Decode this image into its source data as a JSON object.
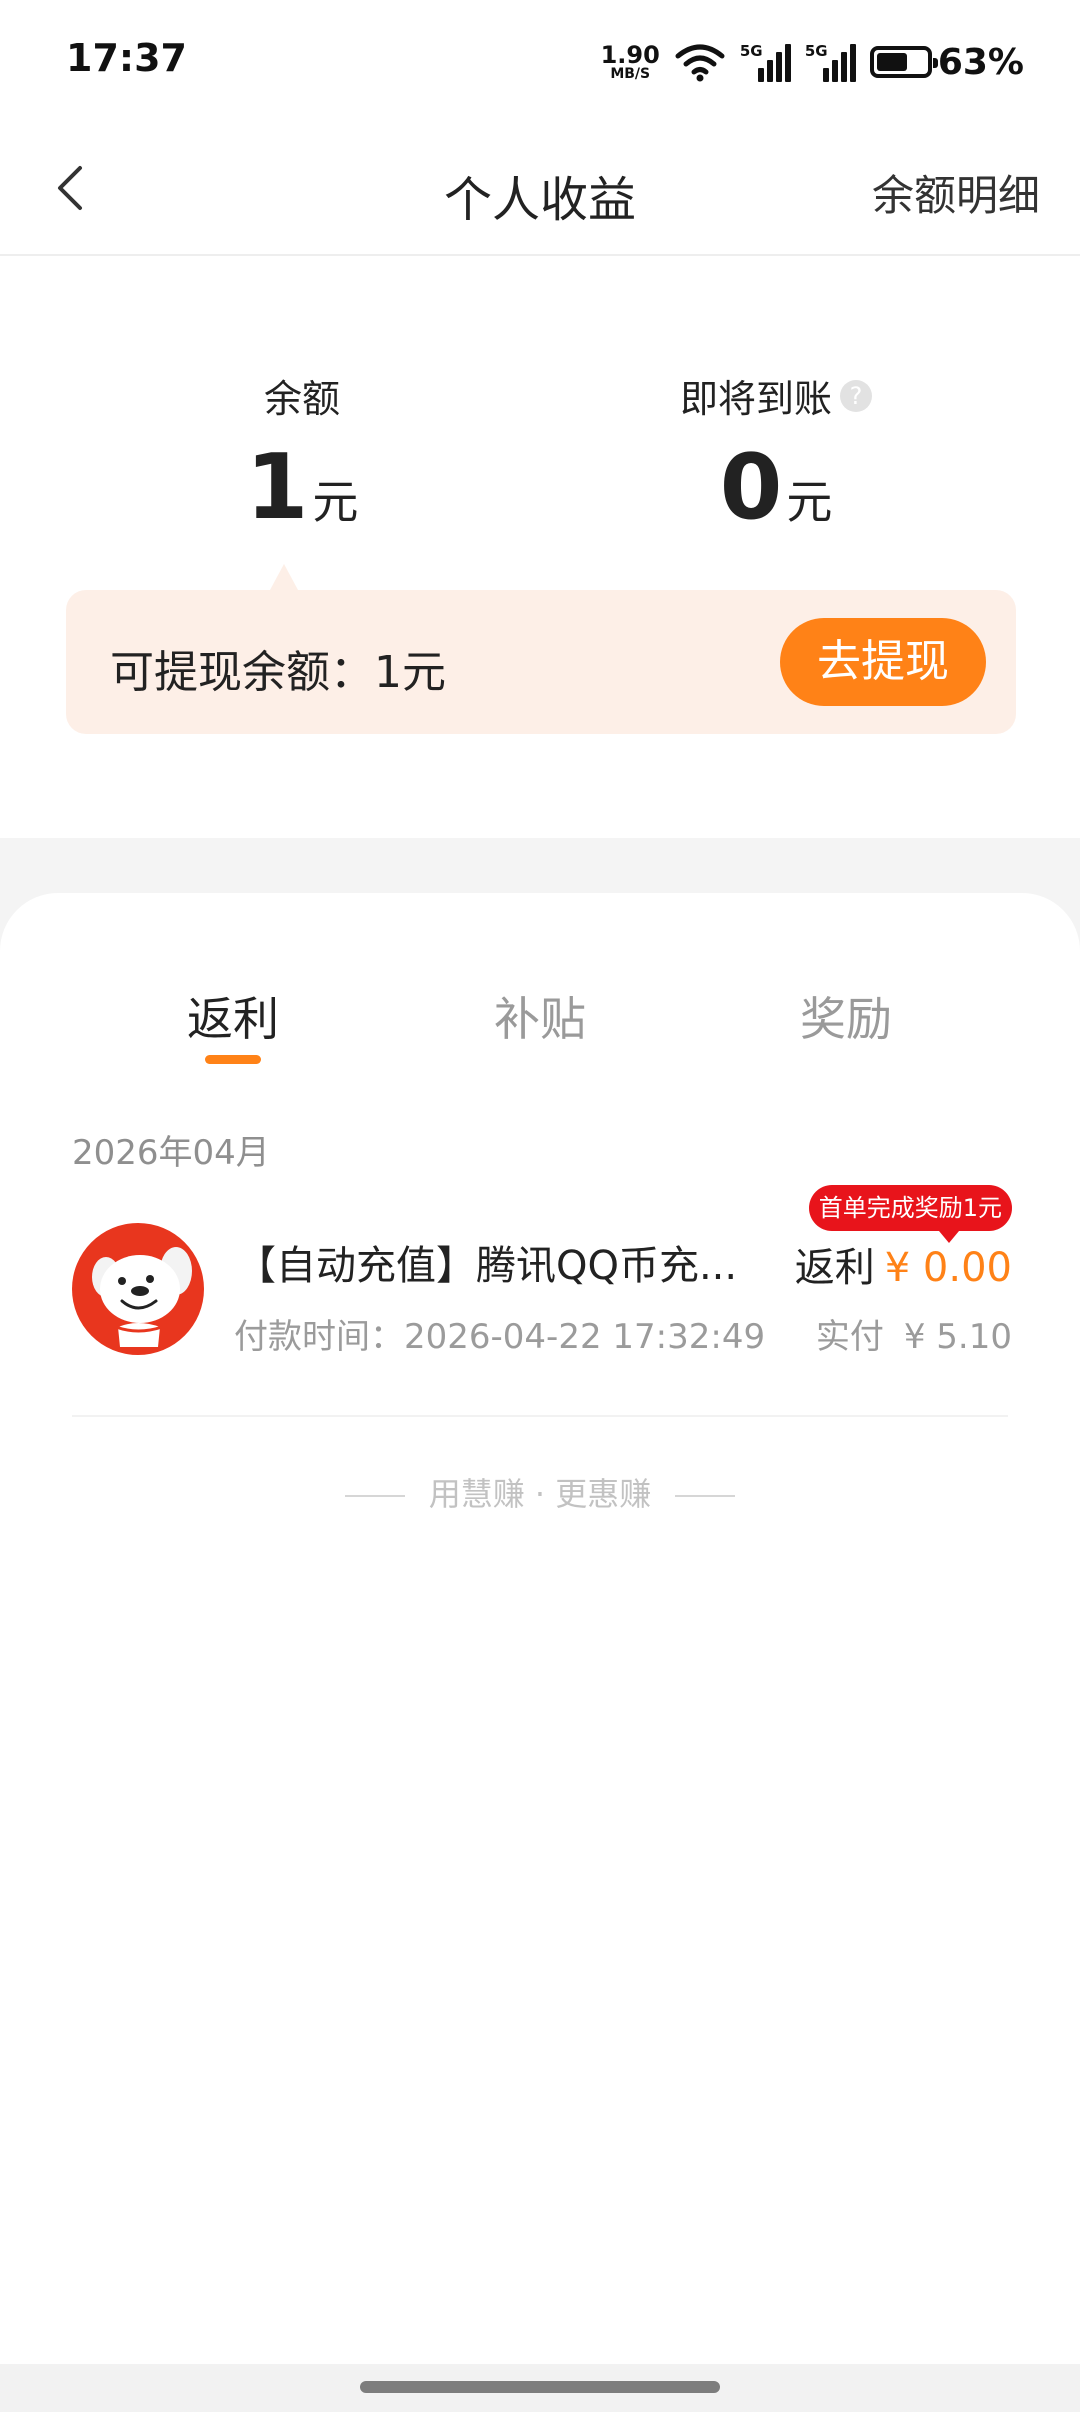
{
  "status_bar": {
    "time": "17:37",
    "net_speed_value": "1.90",
    "net_speed_unit": "MB/S",
    "signal_label_1": "5G",
    "signal_label_2": "5G",
    "battery_level": 0.63,
    "battery_text": "63%",
    "icons": [
      "wifi-icon",
      "signal-icon",
      "signal-icon",
      "battery-icon"
    ]
  },
  "nav": {
    "back_icon": "back-chevron-icon",
    "title": "个人收益",
    "detail_link": "余额明细"
  },
  "balance": {
    "balance_label": "余额",
    "balance_amount": "1",
    "balance_unit": "元",
    "pending_label": "即将到账",
    "pending_help": "?",
    "pending_amount": "0",
    "pending_unit": "元",
    "withdrawable_text": "可提现余额：1元",
    "withdraw_button": "去提现"
  },
  "tabs": [
    {
      "label": "返利",
      "active": true
    },
    {
      "label": "补贴",
      "active": false
    },
    {
      "label": "奖励",
      "active": false
    }
  ],
  "list": {
    "month": "2026年04月",
    "orders": [
      {
        "avatar_icon": "jd-mascot-icon",
        "title": "【自动充值】腾讯QQ币充...",
        "pay_time": "付款时间：2026-04-22 17:32:49",
        "badge": "首单完成奖励1元",
        "rebate_label": "返利",
        "rebate_value": "¥ 0.00",
        "paid_label": "实付",
        "paid_value": "¥ 5.10"
      }
    ]
  },
  "footer": {
    "slogan": "用慧赚 · 更惠赚"
  },
  "colors": {
    "accent": "#ff8217",
    "badge_red": "#e8141b",
    "withdraw_bg": "#fdefe7",
    "page_grey": "#f4f4f4"
  }
}
